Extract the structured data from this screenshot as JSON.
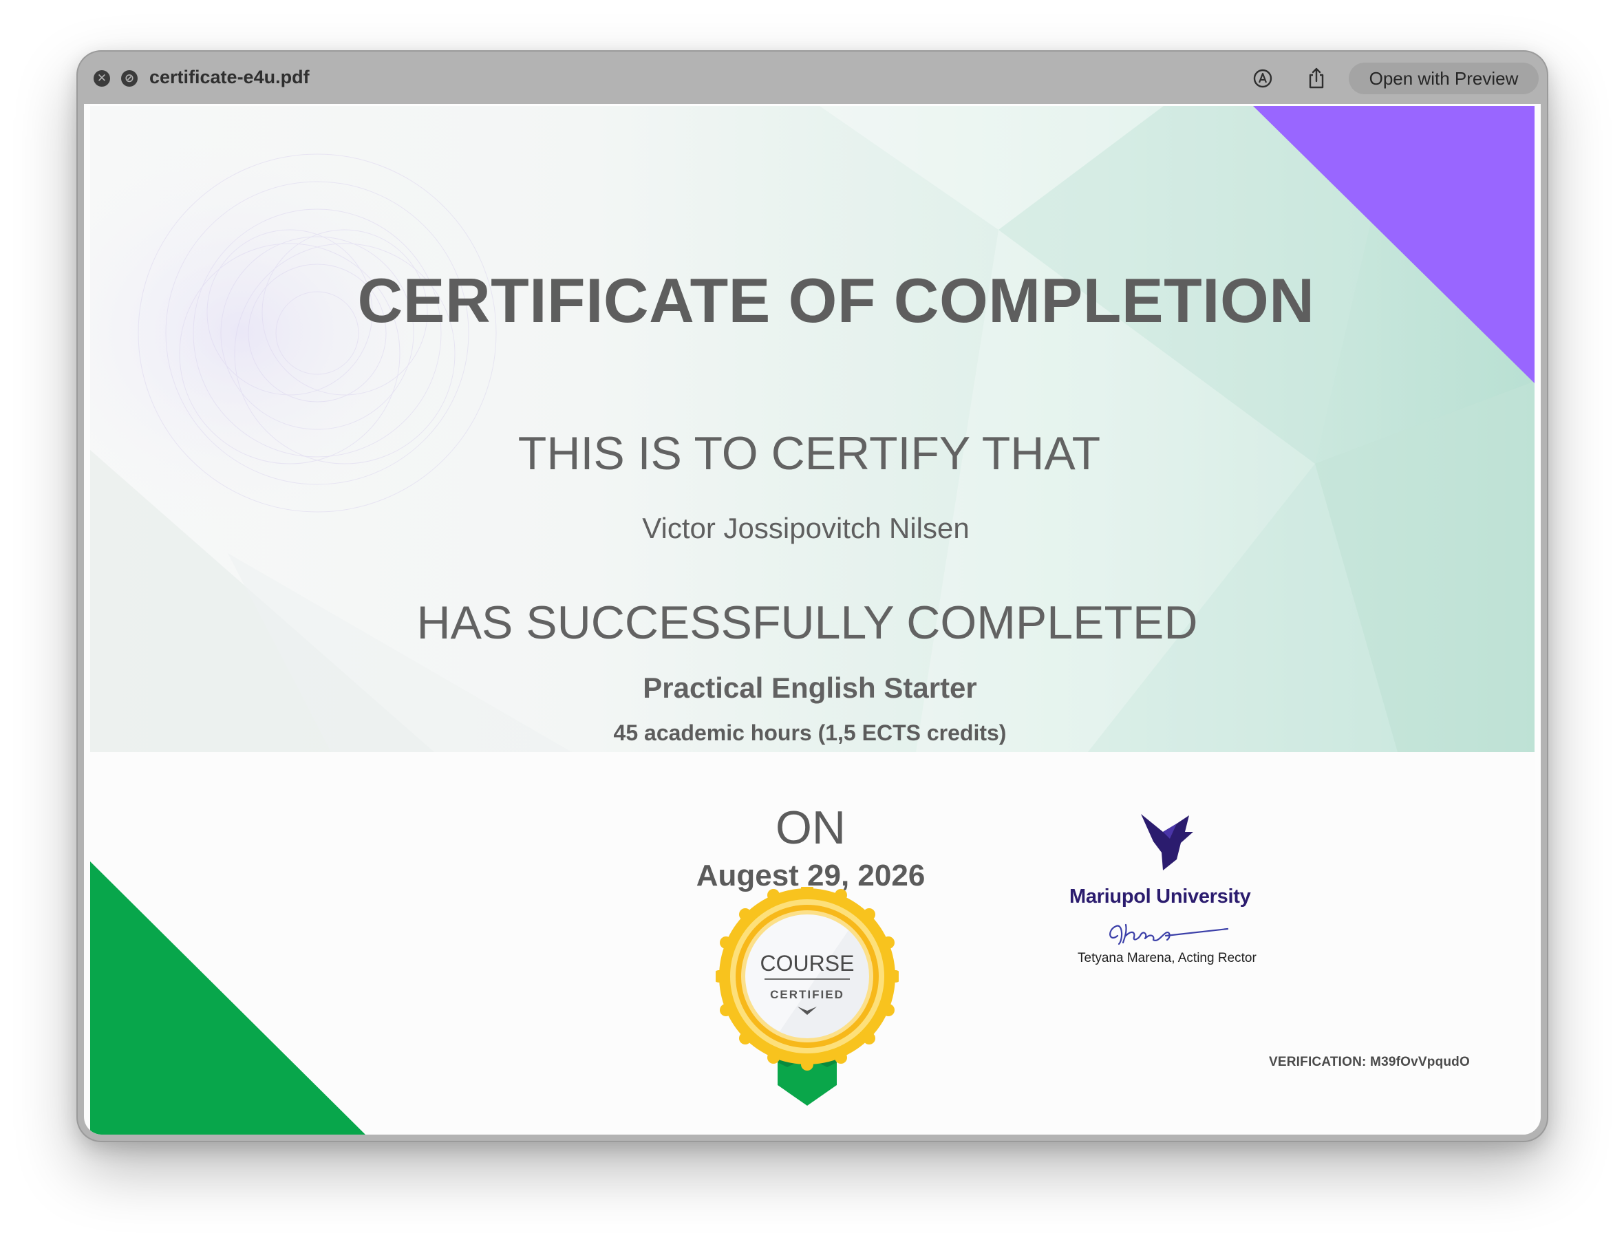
{
  "window": {
    "filename": "certificate-e4u.pdf",
    "close_symbol": "✕",
    "expand_symbol": "⊘",
    "open_button_label": "Open with Preview",
    "icons": [
      "close-icon",
      "expand-icon",
      "markup-icon",
      "share-icon"
    ]
  },
  "certificate": {
    "title": "CERTIFICATE OF COMPLETION",
    "certify_line": "THIS IS TO CERTIFY THAT",
    "recipient_name": "Victor Jossipovitch Nilsen",
    "completed_line": "HAS SUCCESSFULLY COMPLETED",
    "course_name": "Practical English Starter",
    "course_hours": "45 academic hours (1,5 ECTS credits)",
    "on_label": "ON",
    "date": "Augest 29, 2026",
    "badge": {
      "line1": "COURSE",
      "line2": "CERTIFIED"
    },
    "university_name": "Mariupol University",
    "signatory": "Tetyana Marena, Acting Rector",
    "verification": "VERIFICATION: M39fOvVpqudO",
    "colors": {
      "purple_corner": "#9966ff",
      "green_corner": "#08a64b",
      "teal_tint": "#b8dfd2",
      "badge_gold": "#f7c21d",
      "university_navy": "#2b1c6e"
    }
  }
}
